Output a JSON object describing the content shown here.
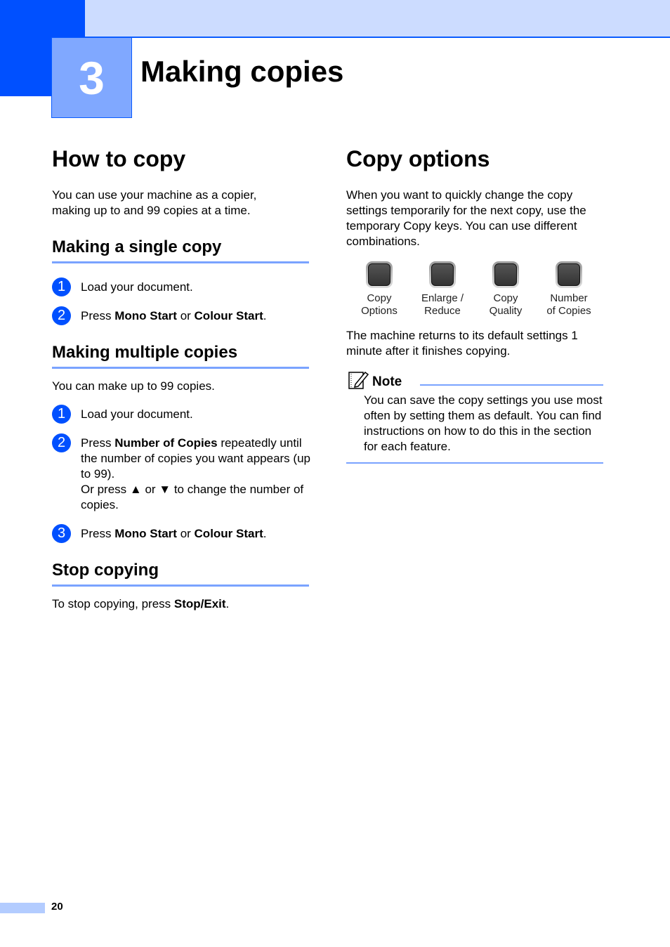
{
  "chapter": {
    "number": "3",
    "title": "Making copies"
  },
  "left": {
    "heading": "How to copy",
    "intro": "You can use your machine as a copier, making up to and 99 copies at a time.",
    "single": {
      "heading": "Making a single copy",
      "steps": [
        {
          "num": "1",
          "parts": [
            {
              "t": "Load your document.",
              "b": false
            }
          ]
        },
        {
          "num": "2",
          "parts": [
            {
              "t": "Press ",
              "b": false
            },
            {
              "t": "Mono Start",
              "b": true
            },
            {
              "t": " or ",
              "b": false
            },
            {
              "t": "Colour Start",
              "b": true
            },
            {
              "t": ".",
              "b": false
            }
          ]
        }
      ]
    },
    "multiple": {
      "heading": "Making multiple copies",
      "intro": "You can make up to 99 copies.",
      "steps": [
        {
          "num": "1",
          "parts": [
            {
              "t": "Load your document.",
              "b": false
            }
          ]
        },
        {
          "num": "2",
          "parts": [
            {
              "t": "Press ",
              "b": false
            },
            {
              "t": "Number of Copies",
              "b": true
            },
            {
              "t": " repeatedly until the number of copies you want appears (up to 99).",
              "b": false
            },
            {
              "t": "\nOr press ▲ or ▼ to change the number of copies.",
              "b": false
            }
          ]
        },
        {
          "num": "3",
          "parts": [
            {
              "t": "Press ",
              "b": false
            },
            {
              "t": "Mono Start",
              "b": true
            },
            {
              "t": " or ",
              "b": false
            },
            {
              "t": "Colour Start",
              "b": true
            },
            {
              "t": ".",
              "b": false
            }
          ]
        }
      ]
    },
    "stop": {
      "heading": "Stop copying",
      "text_prefix": "To stop copying, press ",
      "text_bold": "Stop/Exit",
      "text_suffix": "."
    }
  },
  "right": {
    "heading": "Copy options",
    "intro": "When you want to quickly change the copy settings temporarily for the next copy, use the temporary Copy keys. You can use different combinations.",
    "keys": [
      {
        "line1": "Copy",
        "line2": "Options"
      },
      {
        "line1": "Enlarge /",
        "line2": "Reduce"
      },
      {
        "line1": "Copy",
        "line2": "Quality"
      },
      {
        "line1": "Number",
        "line2": "of Copies"
      }
    ],
    "after_keys": "The machine returns to its default settings 1 minute after it finishes copying.",
    "note": {
      "label": "Note",
      "icon": "note-pencil-icon",
      "text": "You can save the copy settings you use most often by setting them as default. You can find instructions on how to do this in the section for each feature."
    }
  },
  "footer": {
    "page_number": "20"
  },
  "colors": {
    "accent": "#0050ff",
    "light_accent": "#80a8ff",
    "band": "#ccdcff",
    "rule": "#7aa3ff"
  }
}
